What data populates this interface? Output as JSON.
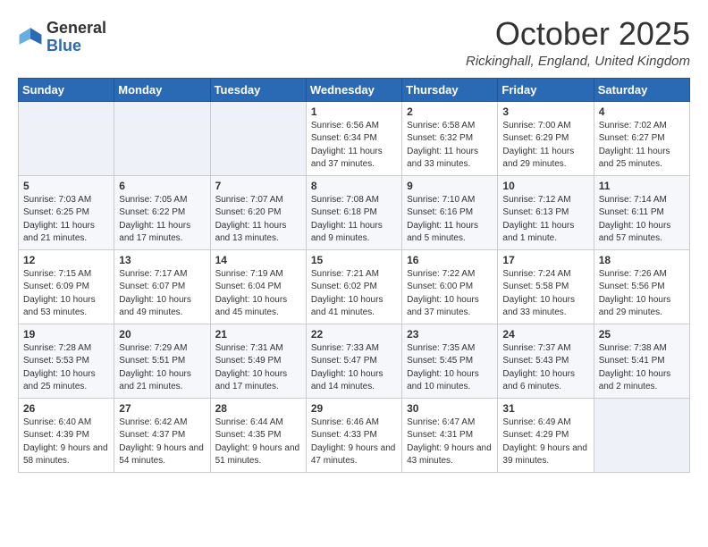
{
  "logo": {
    "general": "General",
    "blue": "Blue"
  },
  "header": {
    "month": "October 2025",
    "location": "Rickinghall, England, United Kingdom"
  },
  "weekdays": [
    "Sunday",
    "Monday",
    "Tuesday",
    "Wednesday",
    "Thursday",
    "Friday",
    "Saturday"
  ],
  "weeks": [
    [
      {
        "day": "",
        "sunrise": "",
        "sunset": "",
        "daylight": ""
      },
      {
        "day": "",
        "sunrise": "",
        "sunset": "",
        "daylight": ""
      },
      {
        "day": "",
        "sunrise": "",
        "sunset": "",
        "daylight": ""
      },
      {
        "day": "1",
        "sunrise": "Sunrise: 6:56 AM",
        "sunset": "Sunset: 6:34 PM",
        "daylight": "Daylight: 11 hours and 37 minutes."
      },
      {
        "day": "2",
        "sunrise": "Sunrise: 6:58 AM",
        "sunset": "Sunset: 6:32 PM",
        "daylight": "Daylight: 11 hours and 33 minutes."
      },
      {
        "day": "3",
        "sunrise": "Sunrise: 7:00 AM",
        "sunset": "Sunset: 6:29 PM",
        "daylight": "Daylight: 11 hours and 29 minutes."
      },
      {
        "day": "4",
        "sunrise": "Sunrise: 7:02 AM",
        "sunset": "Sunset: 6:27 PM",
        "daylight": "Daylight: 11 hours and 25 minutes."
      }
    ],
    [
      {
        "day": "5",
        "sunrise": "Sunrise: 7:03 AM",
        "sunset": "Sunset: 6:25 PM",
        "daylight": "Daylight: 11 hours and 21 minutes."
      },
      {
        "day": "6",
        "sunrise": "Sunrise: 7:05 AM",
        "sunset": "Sunset: 6:22 PM",
        "daylight": "Daylight: 11 hours and 17 minutes."
      },
      {
        "day": "7",
        "sunrise": "Sunrise: 7:07 AM",
        "sunset": "Sunset: 6:20 PM",
        "daylight": "Daylight: 11 hours and 13 minutes."
      },
      {
        "day": "8",
        "sunrise": "Sunrise: 7:08 AM",
        "sunset": "Sunset: 6:18 PM",
        "daylight": "Daylight: 11 hours and 9 minutes."
      },
      {
        "day": "9",
        "sunrise": "Sunrise: 7:10 AM",
        "sunset": "Sunset: 6:16 PM",
        "daylight": "Daylight: 11 hours and 5 minutes."
      },
      {
        "day": "10",
        "sunrise": "Sunrise: 7:12 AM",
        "sunset": "Sunset: 6:13 PM",
        "daylight": "Daylight: 11 hours and 1 minute."
      },
      {
        "day": "11",
        "sunrise": "Sunrise: 7:14 AM",
        "sunset": "Sunset: 6:11 PM",
        "daylight": "Daylight: 10 hours and 57 minutes."
      }
    ],
    [
      {
        "day": "12",
        "sunrise": "Sunrise: 7:15 AM",
        "sunset": "Sunset: 6:09 PM",
        "daylight": "Daylight: 10 hours and 53 minutes."
      },
      {
        "day": "13",
        "sunrise": "Sunrise: 7:17 AM",
        "sunset": "Sunset: 6:07 PM",
        "daylight": "Daylight: 10 hours and 49 minutes."
      },
      {
        "day": "14",
        "sunrise": "Sunrise: 7:19 AM",
        "sunset": "Sunset: 6:04 PM",
        "daylight": "Daylight: 10 hours and 45 minutes."
      },
      {
        "day": "15",
        "sunrise": "Sunrise: 7:21 AM",
        "sunset": "Sunset: 6:02 PM",
        "daylight": "Daylight: 10 hours and 41 minutes."
      },
      {
        "day": "16",
        "sunrise": "Sunrise: 7:22 AM",
        "sunset": "Sunset: 6:00 PM",
        "daylight": "Daylight: 10 hours and 37 minutes."
      },
      {
        "day": "17",
        "sunrise": "Sunrise: 7:24 AM",
        "sunset": "Sunset: 5:58 PM",
        "daylight": "Daylight: 10 hours and 33 minutes."
      },
      {
        "day": "18",
        "sunrise": "Sunrise: 7:26 AM",
        "sunset": "Sunset: 5:56 PM",
        "daylight": "Daylight: 10 hours and 29 minutes."
      }
    ],
    [
      {
        "day": "19",
        "sunrise": "Sunrise: 7:28 AM",
        "sunset": "Sunset: 5:53 PM",
        "daylight": "Daylight: 10 hours and 25 minutes."
      },
      {
        "day": "20",
        "sunrise": "Sunrise: 7:29 AM",
        "sunset": "Sunset: 5:51 PM",
        "daylight": "Daylight: 10 hours and 21 minutes."
      },
      {
        "day": "21",
        "sunrise": "Sunrise: 7:31 AM",
        "sunset": "Sunset: 5:49 PM",
        "daylight": "Daylight: 10 hours and 17 minutes."
      },
      {
        "day": "22",
        "sunrise": "Sunrise: 7:33 AM",
        "sunset": "Sunset: 5:47 PM",
        "daylight": "Daylight: 10 hours and 14 minutes."
      },
      {
        "day": "23",
        "sunrise": "Sunrise: 7:35 AM",
        "sunset": "Sunset: 5:45 PM",
        "daylight": "Daylight: 10 hours and 10 minutes."
      },
      {
        "day": "24",
        "sunrise": "Sunrise: 7:37 AM",
        "sunset": "Sunset: 5:43 PM",
        "daylight": "Daylight: 10 hours and 6 minutes."
      },
      {
        "day": "25",
        "sunrise": "Sunrise: 7:38 AM",
        "sunset": "Sunset: 5:41 PM",
        "daylight": "Daylight: 10 hours and 2 minutes."
      }
    ],
    [
      {
        "day": "26",
        "sunrise": "Sunrise: 6:40 AM",
        "sunset": "Sunset: 4:39 PM",
        "daylight": "Daylight: 9 hours and 58 minutes."
      },
      {
        "day": "27",
        "sunrise": "Sunrise: 6:42 AM",
        "sunset": "Sunset: 4:37 PM",
        "daylight": "Daylight: 9 hours and 54 minutes."
      },
      {
        "day": "28",
        "sunrise": "Sunrise: 6:44 AM",
        "sunset": "Sunset: 4:35 PM",
        "daylight": "Daylight: 9 hours and 51 minutes."
      },
      {
        "day": "29",
        "sunrise": "Sunrise: 6:46 AM",
        "sunset": "Sunset: 4:33 PM",
        "daylight": "Daylight: 9 hours and 47 minutes."
      },
      {
        "day": "30",
        "sunrise": "Sunrise: 6:47 AM",
        "sunset": "Sunset: 4:31 PM",
        "daylight": "Daylight: 9 hours and 43 minutes."
      },
      {
        "day": "31",
        "sunrise": "Sunrise: 6:49 AM",
        "sunset": "Sunset: 4:29 PM",
        "daylight": "Daylight: 9 hours and 39 minutes."
      },
      {
        "day": "",
        "sunrise": "",
        "sunset": "",
        "daylight": ""
      }
    ]
  ]
}
